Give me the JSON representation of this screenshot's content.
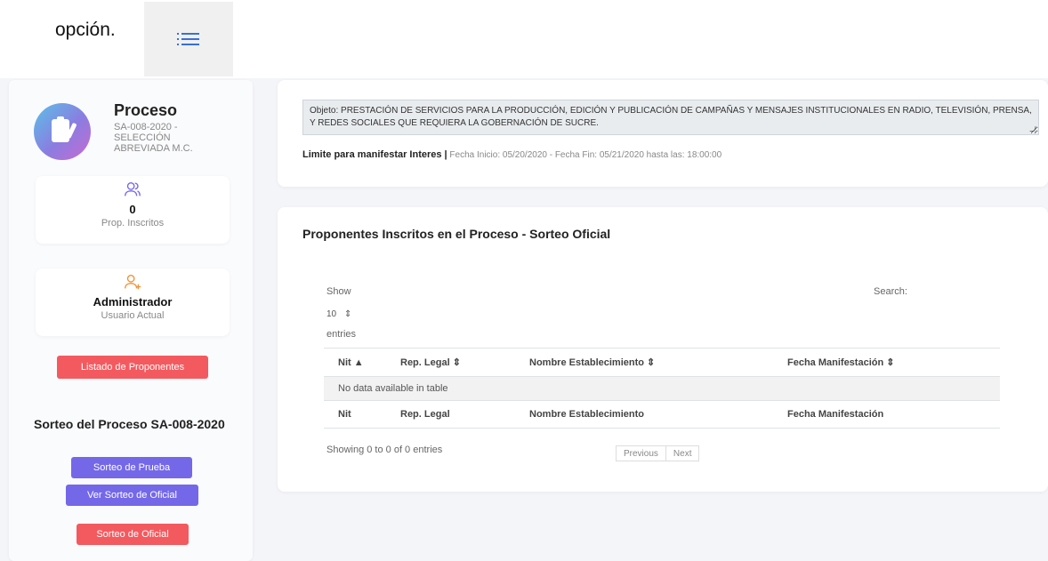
{
  "top": {
    "fragment_text": "opción.",
    "menu_icon": "list-icon"
  },
  "sidebar": {
    "process": {
      "title": "Proceso",
      "subtitle": "SA-008-2020 - SELECCIÓN ABREVIADA M.C.",
      "icon": "clipboard-icon"
    },
    "card_inscritos": {
      "value": "0",
      "label": "Prop. Inscritos",
      "icon": "users-icon"
    },
    "card_user": {
      "name": "Administrador",
      "label": "Usuario Actual",
      "icon": "user-add-icon"
    },
    "listado_button": "Listado de Proponentes",
    "sorteo_heading": "Sorteo del Proceso SA-008-2020",
    "sorteo_prueba_button": "Sorteo de Prueba",
    "ver_sorteo_button": "Ver Sorteo de Oficial",
    "sorteo_oficial_button": "Sorteo de Oficial"
  },
  "header_panel": {
    "objeto": "Objeto: PRESTACIÓN DE SERVICIOS PARA LA PRODUCCIÓN, EDICIÓN Y PUBLICACIÓN DE CAMPAÑAS Y MENSAJES INSTITUCIONALES EN RADIO, TELEVISIÓN, PRENSA, Y REDES SOCIALES QUE REQUIERA LA GOBERNACIÓN DE SUCRE.",
    "limite_label": "Limite para manifestar Interes |",
    "fechas": " Fecha Inicio: 05/20/2020 - Fecha Fin: 05/21/2020 hasta las: 18:00:00"
  },
  "table_panel": {
    "title": "Proponentes Inscritos en el Proceso - Sorteo Oficial",
    "show_label": "Show",
    "page_length": "10",
    "entries_label": "entries",
    "search_label": "Search:",
    "columns": [
      "Nit",
      "Rep. Legal",
      "Nombre Establecimiento",
      "Fecha Manifestación"
    ],
    "empty_message": "No data available in table",
    "info": "Showing 0 to 0 of 0 entries",
    "previous": "Previous",
    "next": "Next"
  },
  "colors": {
    "red_button": "#f35a5f",
    "purple_button": "#7468e8",
    "accent": "#3a6fd6"
  }
}
